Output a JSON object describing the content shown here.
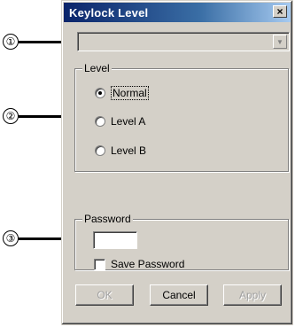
{
  "window": {
    "title": "Keylock Level",
    "close_glyph": "×"
  },
  "combo": {
    "value": ""
  },
  "level_group": {
    "label": "Level",
    "options": [
      {
        "label": "Normal",
        "checked": true
      },
      {
        "label": "Level A",
        "checked": false
      },
      {
        "label": "Level B",
        "checked": false
      }
    ]
  },
  "password_group": {
    "label": "Password",
    "input_value": "",
    "save_label": "Save Password",
    "save_checked": false
  },
  "buttons": {
    "ok": "OK",
    "cancel": "Cancel",
    "apply": "Apply"
  },
  "callouts": [
    "①",
    "②",
    "③"
  ]
}
